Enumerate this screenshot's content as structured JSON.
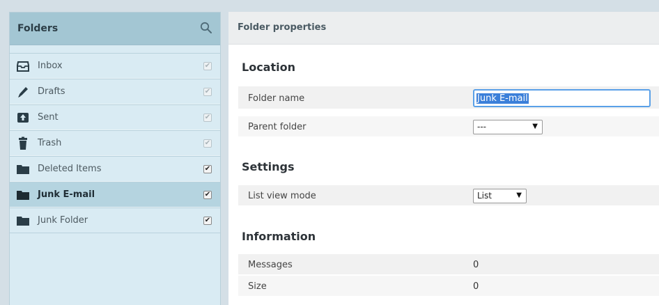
{
  "folders": {
    "title": "Folders",
    "search_icon": "search-icon",
    "items": [
      {
        "label": "Inbox",
        "icon": "inbox-icon",
        "subscribed": true,
        "locked": true
      },
      {
        "label": "Drafts",
        "icon": "pencil-icon",
        "subscribed": true,
        "locked": true
      },
      {
        "label": "Sent",
        "icon": "sent-icon",
        "subscribed": true,
        "locked": true
      },
      {
        "label": "Trash",
        "icon": "trash-icon",
        "subscribed": true,
        "locked": true
      },
      {
        "label": "Deleted Items",
        "icon": "folder-icon",
        "subscribed": true,
        "locked": false
      },
      {
        "label": "Junk E-mail",
        "icon": "folder-icon",
        "subscribed": true,
        "locked": false,
        "selected": true
      },
      {
        "label": "Junk Folder",
        "icon": "folder-icon",
        "subscribed": true,
        "locked": false
      }
    ]
  },
  "properties": {
    "title": "Folder properties",
    "location": {
      "heading": "Location",
      "folder_name_label": "Folder name",
      "folder_name_value": "Junk E-mail",
      "parent_folder_label": "Parent folder",
      "parent_folder_value": "---"
    },
    "settings": {
      "heading": "Settings",
      "list_view_label": "List view mode",
      "list_view_value": "List"
    },
    "information": {
      "heading": "Information",
      "messages_label": "Messages",
      "messages_value": "0",
      "size_label": "Size",
      "size_value": "0"
    }
  },
  "colors": {
    "folders_header": "#a3c6d3",
    "folders_bg": "#d9ebf3",
    "selected_row": "#b5d4e0",
    "input_focus": "#5aa0e8",
    "text_selection": "#3b7fd9"
  }
}
